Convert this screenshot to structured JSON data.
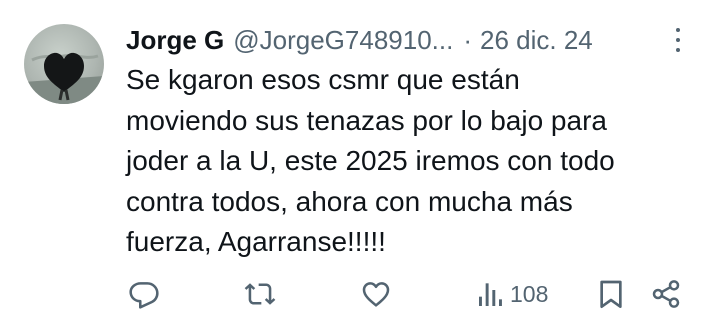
{
  "tweet": {
    "author_name": "Jorge G",
    "handle": "@JorgeG748910...",
    "separator": "·",
    "date": "26 dic. 24",
    "text": "Se kgaron esos csmr que están\nmoviendo sus tenazas por lo bajo para\njoder a la U, este 2025 iremos con todo\ncontra todos, ahora con mucha más\nfuerza, Agarranse!!!!!"
  },
  "actions": {
    "views_count": "108"
  },
  "icons": {
    "avatar": "heart-avatar",
    "more": "more-vertical-icon",
    "reply": "reply-icon",
    "retweet": "retweet-icon",
    "like": "like-icon",
    "views": "views-icon",
    "bookmark": "bookmark-icon",
    "share": "share-icon"
  },
  "colors": {
    "text_primary": "#0f1419",
    "text_secondary": "#536471",
    "background": "#ffffff"
  }
}
